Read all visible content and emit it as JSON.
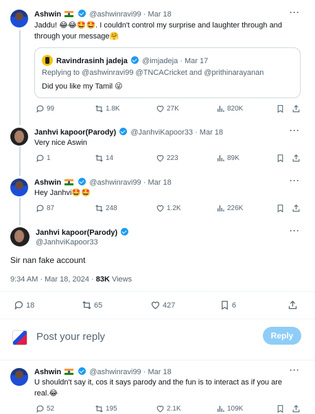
{
  "posts": [
    {
      "name": "Ashwin",
      "handle": "@ashwinravi99",
      "date": "· Mar 18",
      "text_line1": "Jaddu! 😂😂🤩🤩. I couldn't control my surprise and laughter through and",
      "text_line2": "through your message🤗",
      "quote": {
        "name": "Ravindrasinh jadeja",
        "handle": "@imjadeja",
        "date": "· Mar 17",
        "reply_line": "Replying to @ashwinravi99 @TNCACricket and @prithinarayanan",
        "text": "Did you like my Tamil 😜"
      },
      "stats": {
        "replies": "99",
        "reposts": "1.8K",
        "likes": "27K",
        "views": "820K"
      }
    },
    {
      "name": "Janhvi kapoor(Parody)",
      "handle": "@JanhviKapoor33",
      "date": "· Mar 18",
      "text": "Very nice Aswin",
      "stats": {
        "replies": "1",
        "reposts": "14",
        "likes": "223",
        "views": "89K"
      }
    },
    {
      "name": "Ashwin",
      "handle": "@ashwinravi99",
      "date": "· Mar 18",
      "text": "Hey Janhvi🤩🤩",
      "stats": {
        "replies": "87",
        "reposts": "248",
        "likes": "1.2K",
        "views": "226K"
      }
    }
  ],
  "main_post": {
    "name": "Janhvi kapoor(Parody)",
    "handle": "@JanhviKapoor33",
    "text": "Sir nan fake account",
    "time": "9:34 AM · Mar 18, 2024 · ",
    "views_count": "83K",
    "views_label": " Views",
    "stats": {
      "replies": "18",
      "reposts": "65",
      "likes": "427",
      "bookmarks": "6"
    }
  },
  "composer": {
    "placeholder": "Post your reply",
    "button": "Reply"
  },
  "reply_post": {
    "name": "Ashwin",
    "handle": "@ashwinravi99",
    "date": "· Mar 18",
    "text_line1": "U shouldn't say it, cos it says parody and the fun is to interact as if you are",
    "text_line2": "real.😂",
    "stats": {
      "replies": "52",
      "reposts": "195",
      "likes": "2.1K",
      "views": "109K"
    }
  },
  "icons": [
    "more-icon",
    "reply-icon",
    "repost-icon",
    "like-icon",
    "views-icon",
    "bookmark-icon",
    "share-icon",
    "verified-icon",
    "india-flag-icon"
  ],
  "colors": {
    "accent": "#1d9bf0",
    "reply_button": "#8ecdf7",
    "muted": "#536471",
    "border": "#cfd9de"
  }
}
